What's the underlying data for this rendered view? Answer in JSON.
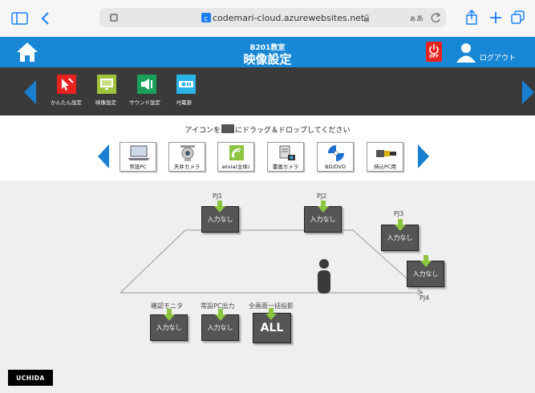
{
  "browser": {
    "url": "codemari-cloud.azurewebsites.net",
    "text_size_label": "ぁあ"
  },
  "header": {
    "room": "B201教室",
    "title": "映像設定",
    "power_label": "OFF",
    "logout_label": "ログアウト"
  },
  "toolbar": {
    "items": [
      {
        "label": "かんたん設定"
      },
      {
        "label": "映像設定"
      },
      {
        "label": "サウンド設定"
      },
      {
        "label": "PJ電源"
      }
    ]
  },
  "palette": {
    "instruction_before": "アイコンを",
    "instruction_after": "にドラッグ＆ドロップしてください",
    "sources": [
      {
        "label": "常設PC"
      },
      {
        "label": "天井カメラ"
      },
      {
        "label": "wivia(全体)"
      },
      {
        "label": "書画カメラ"
      },
      {
        "label": "BD/DVD"
      },
      {
        "label": "持込PC用"
      }
    ]
  },
  "outputs": {
    "pj1": {
      "label": "PJ1",
      "value": "入力なし"
    },
    "pj2": {
      "label": "PJ2",
      "value": "入力なし"
    },
    "pj3": {
      "label": "PJ3",
      "value": "入力なし"
    },
    "pj4": {
      "label": "PJ4",
      "value": "入力なし"
    },
    "monitor": {
      "label": "確認モニタ",
      "value": "入力なし"
    },
    "pc_out": {
      "label": "常設PC出力",
      "value": "入力なし"
    },
    "all": {
      "label": "全画面一括投影",
      "value": "ALL"
    }
  },
  "brand": "UCHIDA",
  "colors": {
    "header_blue": "#1888d6",
    "toolbar_dark": "#3a3a3a",
    "arrow_blue": "#1a7fd0",
    "drop_green": "#8cc63f",
    "box_gray": "#555555",
    "power_red": "#e8221f"
  }
}
